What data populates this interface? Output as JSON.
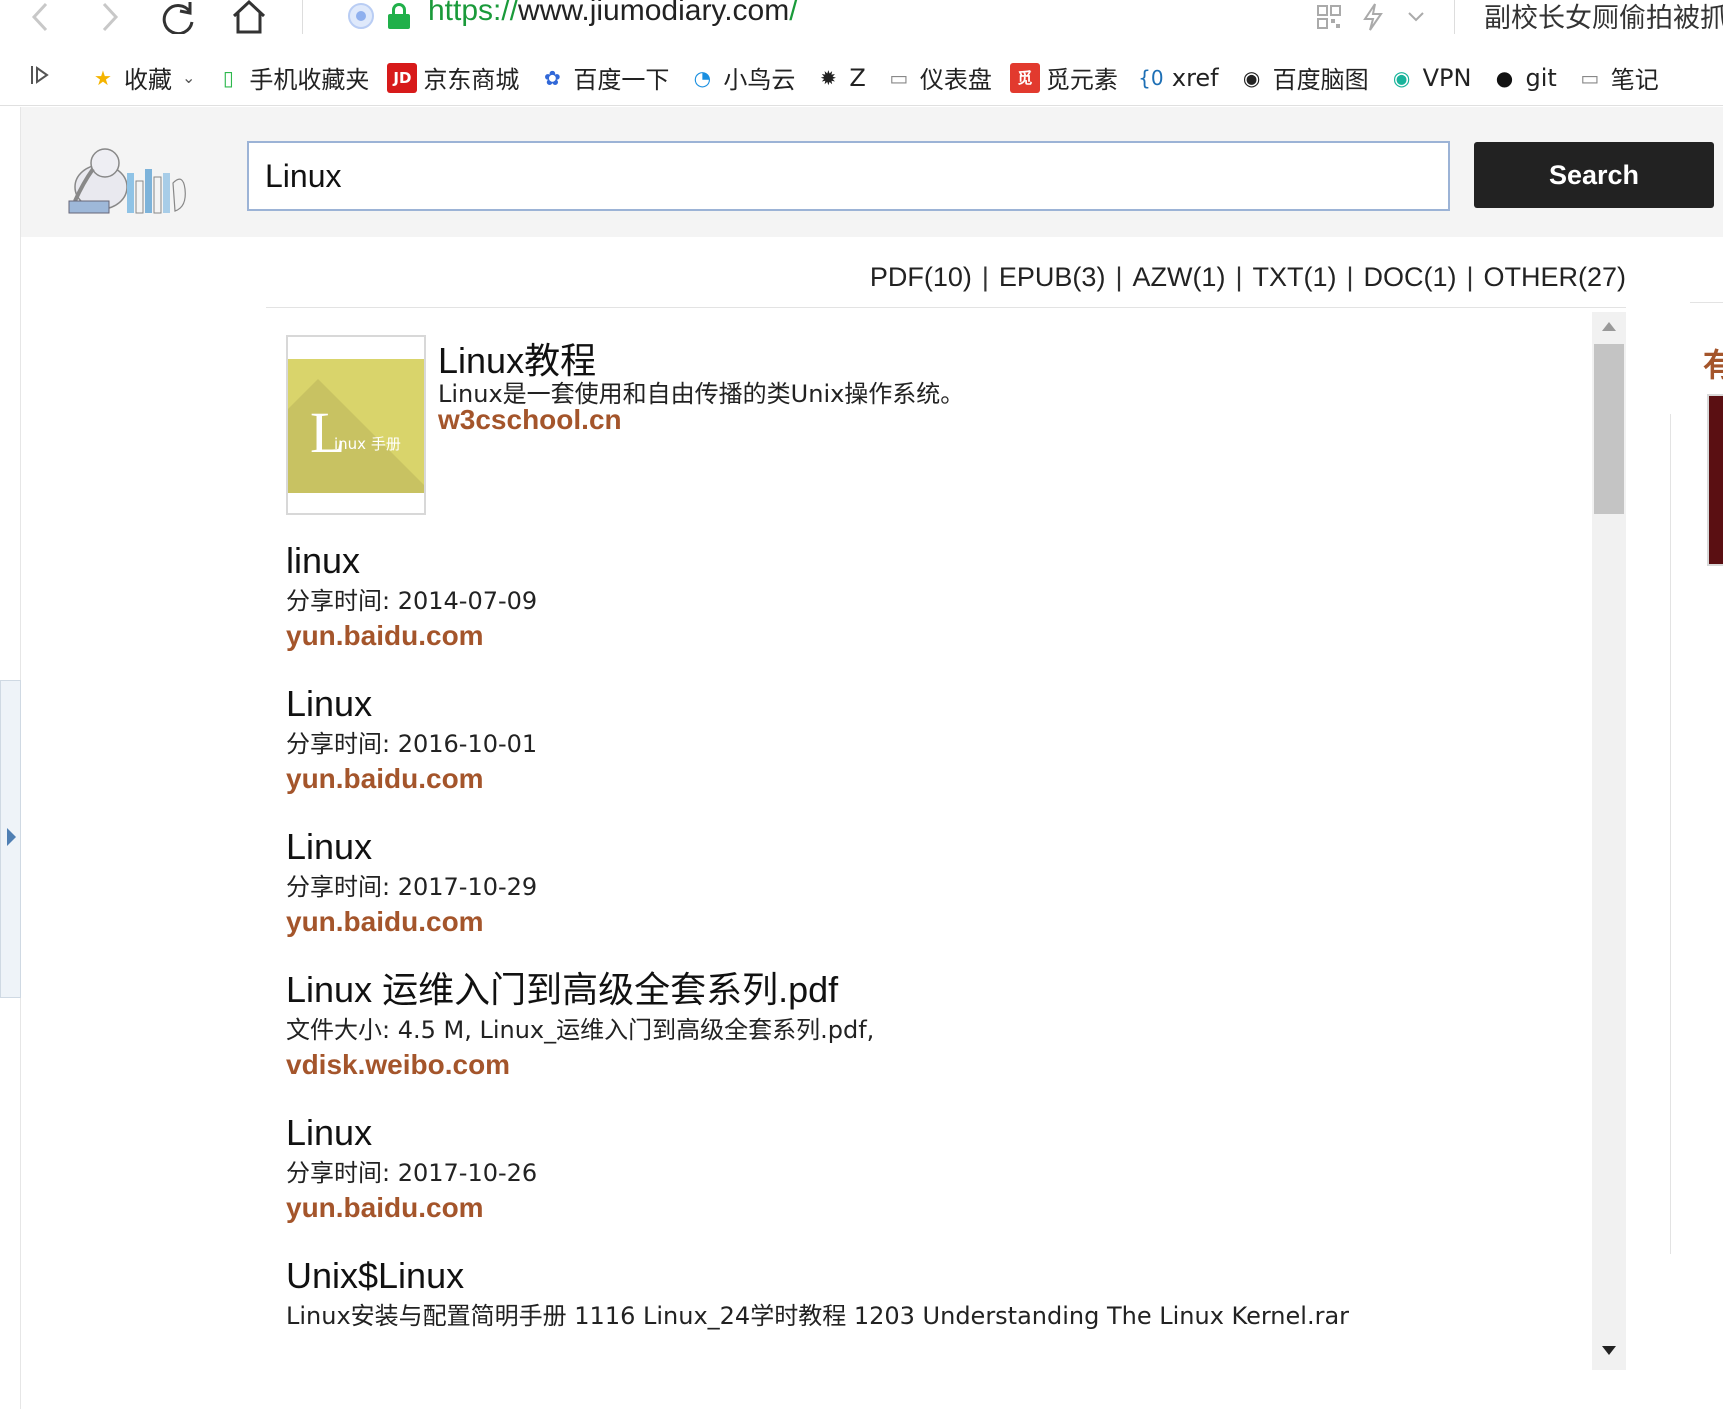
{
  "browser": {
    "url_scheme": "https://",
    "url_host": "www.jiumodiary.com",
    "url_path": "/",
    "news_ticker": "副校长女厕偷拍被抓"
  },
  "bookmarks": [
    {
      "label": "收藏",
      "icon": "star-icon",
      "color": "#f5b400"
    },
    {
      "label": "手机收藏夹",
      "icon": "phone-icon",
      "color": "#2db84d"
    },
    {
      "label": "京东商城",
      "icon": "jd-icon",
      "color": "#d71a1a"
    },
    {
      "label": "百度一下",
      "icon": "baidu-paw-icon",
      "color": "#3168d8"
    },
    {
      "label": "小鸟云",
      "icon": "swirl-icon",
      "color": "#1a8fe0"
    },
    {
      "label": "Z",
      "icon": "gear-icon",
      "color": "#222222"
    },
    {
      "label": "仪表盘",
      "icon": "page-icon",
      "color": "#888888"
    },
    {
      "label": "觅元素",
      "icon": "mi-icon",
      "color": "#e23a2e"
    },
    {
      "label": "xref",
      "icon": "brace-icon",
      "color": "#1d6fb5"
    },
    {
      "label": "百度脑图",
      "icon": "owl-icon",
      "color": "#222222"
    },
    {
      "label": "VPN",
      "icon": "vpn-icon",
      "color": "#19b49b"
    },
    {
      "label": "git",
      "icon": "github-icon",
      "color": "#111111"
    },
    {
      "label": "笔记",
      "icon": "page-icon",
      "color": "#888888"
    }
  ],
  "search": {
    "value": "Linux",
    "button_label": "Search"
  },
  "filters": [
    {
      "label": "PDF(10)"
    },
    {
      "label": "EPUB(3)"
    },
    {
      "label": "AZW(1)"
    },
    {
      "label": "TXT(1)"
    },
    {
      "label": "DOC(1)"
    },
    {
      "label": "OTHER(27)"
    }
  ],
  "featured": {
    "cover_big_letter": "L",
    "cover_text": "inux 手册",
    "title": "Linux教程",
    "description": "Linux是一套使用和自由传播的类Unix操作系统。",
    "link": "w3cschool.cn"
  },
  "results": [
    {
      "title": "linux",
      "meta": "分享时间: 2014-07-09",
      "link": "yun.baidu.com"
    },
    {
      "title": "Linux",
      "meta": "分享时间: 2016-10-01",
      "link": "yun.baidu.com"
    },
    {
      "title": "Linux",
      "meta": "分享时间: 2017-10-29",
      "link": "yun.baidu.com"
    },
    {
      "title": "Linux 运维入门到高级全套系列.pdf",
      "meta": "文件大小: 4.5 M, Linux_运维入门到高级全套系列.pdf,",
      "link": "vdisk.weibo.com"
    },
    {
      "title": "Linux",
      "meta": "分享时间: 2017-10-26",
      "link": "yun.baidu.com"
    },
    {
      "title": "Unix$Linux",
      "meta": "Linux安装与配置简明手册 1116 Linux_24学时教程 1203 Understanding The Linux Kernel.rar",
      "link": ""
    }
  ],
  "right_peek_char": "有",
  "colors": {
    "link": "#a4552b",
    "header_bg": "#f4f4f4",
    "search_button": "#222222",
    "url_green": "#1a9a3a"
  }
}
